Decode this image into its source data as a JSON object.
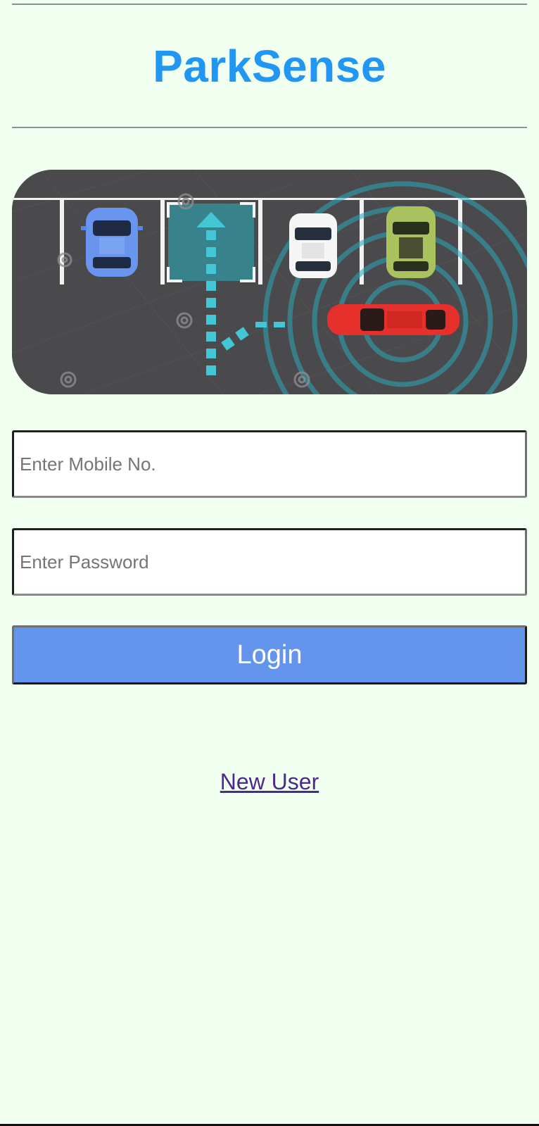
{
  "app": {
    "title": "ParkSense",
    "title_color": "#2196F3",
    "background_color": "#F0FFF0"
  },
  "hero_image": {
    "description_icon": "parking-lot-illustration",
    "watermark": "dreamstime"
  },
  "form": {
    "mobile_placeholder": "Enter Mobile No.",
    "mobile_value": "",
    "password_placeholder": "Enter Password",
    "password_value": "",
    "login_label": "Login",
    "login_color": "#6495ED"
  },
  "links": {
    "new_user": "New User",
    "new_user_color": "#4B2A8A"
  }
}
